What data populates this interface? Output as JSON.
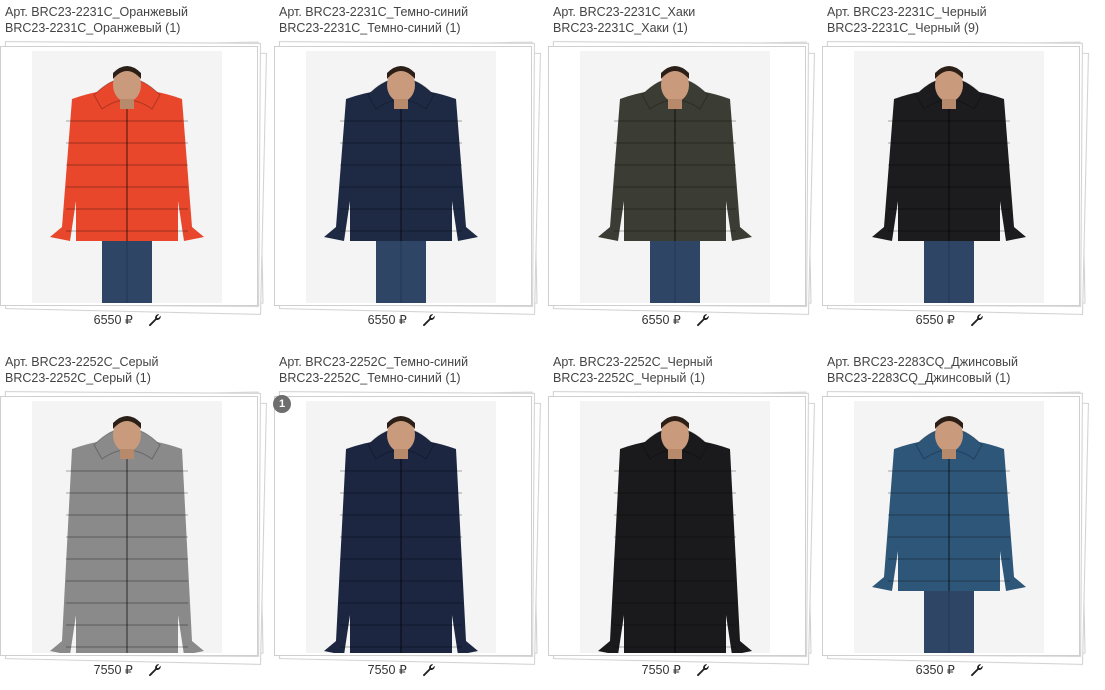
{
  "products": [
    {
      "title": "Арт. BRC23-2231C_Оранжевый",
      "subtitle": "BRC23-2231C_Оранжевый (1)",
      "price": "6550 ₽",
      "jacket_color": "#e8472c",
      "badge": ""
    },
    {
      "title": "Арт. BRC23-2231C_Темно-синий",
      "subtitle": "BRC23-2231C_Темно-синий (1)",
      "price": "6550 ₽",
      "jacket_color": "#1e2a44",
      "badge": ""
    },
    {
      "title": "Арт. BRC23-2231C_Хаки",
      "subtitle": "BRC23-2231C_Хаки (1)",
      "price": "6550 ₽",
      "jacket_color": "#3b3c33",
      "badge": ""
    },
    {
      "title": "Арт. BRC23-2231C_Черный",
      "subtitle": "BRC23-2231C_Черный (9)",
      "price": "6550 ₽",
      "jacket_color": "#1c1c1f",
      "badge": ""
    },
    {
      "title": "Арт. BRC23-2252C_Серый",
      "subtitle": "BRC23-2252C_Серый (1)",
      "price": "7550 ₽",
      "jacket_color": "#8a8a8a",
      "badge": ""
    },
    {
      "title": "Арт. BRC23-2252C_Темно-синий",
      "subtitle": "BRC23-2252C_Темно-синий (1)",
      "price": "7550 ₽",
      "jacket_color": "#1c2641",
      "badge": "1"
    },
    {
      "title": "Арт. BRC23-2252C_Черный",
      "subtitle": "BRC23-2252C_Черный (1)",
      "price": "7550 ₽",
      "jacket_color": "#1a1a1c",
      "badge": ""
    },
    {
      "title": "Арт. BRC23-2283CQ_Джинсовый",
      "subtitle": "BRC23-2283CQ_Джинсовый (1)",
      "price": "6350 ₽",
      "jacket_color": "#2d5679",
      "badge": ""
    }
  ],
  "icons": {
    "edit": "wrench-icon"
  }
}
